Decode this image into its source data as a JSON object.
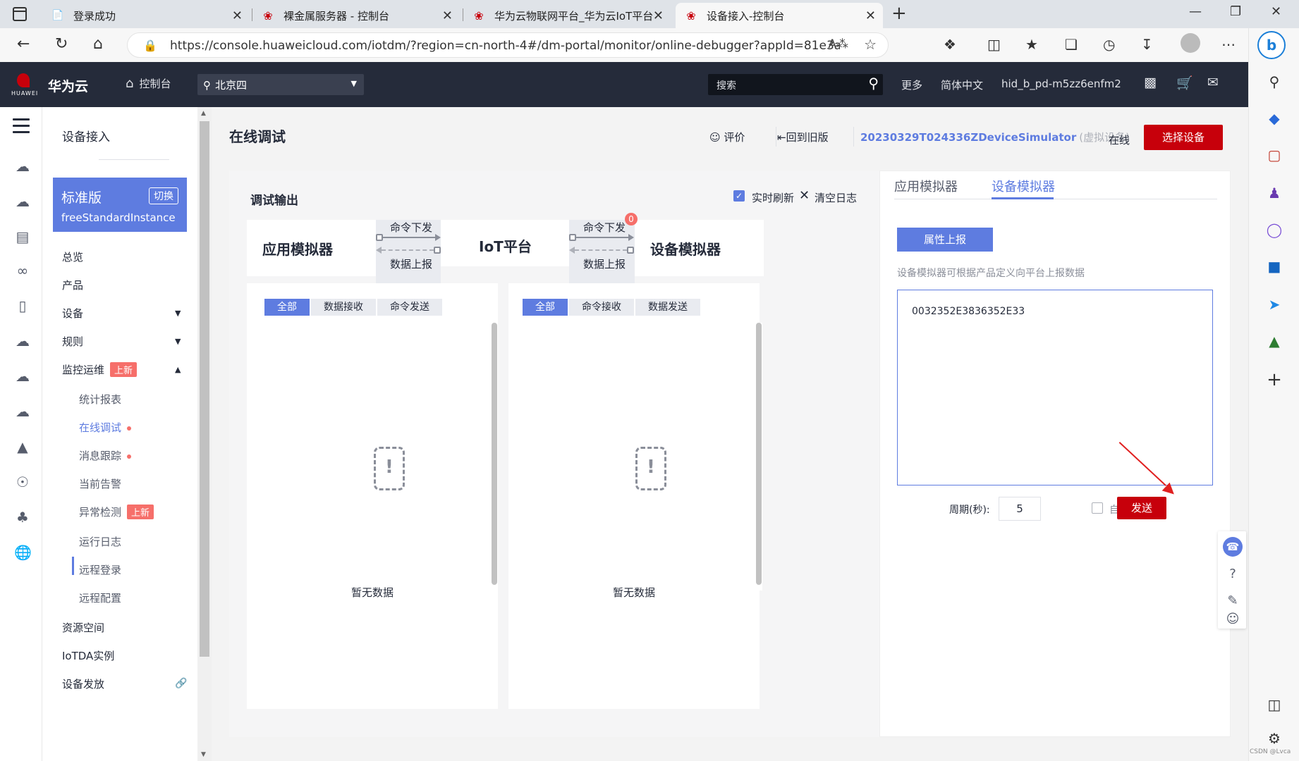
{
  "browser": {
    "tabs": [
      {
        "title": "登录成功",
        "icon": "page-icon"
      },
      {
        "title": "裸金属服务器 - 控制台",
        "icon": "huawei-icon"
      },
      {
        "title": "华为云物联网平台_华为云IoT平台",
        "icon": "huawei-icon"
      },
      {
        "title": "设备接入-控制台",
        "icon": "huawei-icon"
      }
    ],
    "url": "https://console.huaweicloud.com/iotdm/?region=cn-north-4#/dm-portal/monitor/online-debugger?appId=81e3a7005bca45..."
  },
  "header": {
    "logo_text": "HUAWEI",
    "brand": "华为云",
    "console": "控制台",
    "region": "北京四",
    "search_placeholder": "搜索",
    "more": "更多",
    "language": "简体中文",
    "user": "hid_b_pd-m5zz6enfm2"
  },
  "sidebar": {
    "section_title": "设备接入",
    "edition": {
      "name": "标准版",
      "switch": "切换",
      "instance": "freeStandardInstance"
    },
    "items": [
      {
        "label": "总览"
      },
      {
        "label": "产品"
      },
      {
        "label": "设备"
      },
      {
        "label": "规则"
      },
      {
        "label": "监控运维",
        "badge": "上新"
      },
      {
        "label": "统计报表"
      },
      {
        "label": "在线调试"
      },
      {
        "label": "消息跟踪"
      },
      {
        "label": "当前告警"
      },
      {
        "label": "异常检测",
        "badge": "上新"
      },
      {
        "label": "运行日志"
      },
      {
        "label": "远程登录"
      },
      {
        "label": "远程配置"
      },
      {
        "label": "资源空间"
      },
      {
        "label": "IoTDA实例"
      },
      {
        "label": "设备发放"
      }
    ]
  },
  "page": {
    "title": "在线调试",
    "rate": "评价",
    "back_old": "回到旧版",
    "device_name": "20230329T024336ZDeviceSimulator",
    "device_virtual": "(虚拟设备)",
    "status": "在线",
    "select_device": "选择设备"
  },
  "debug": {
    "title": "调试输出",
    "realtime_refresh": "实时刷新",
    "clear_log": "清空日志",
    "app_simulator": "应用模拟器",
    "platform": "IoT平台",
    "device_simulator": "设备模拟器",
    "cmd_down": "命令下发",
    "data_up": "数据上报",
    "badge_count": "0",
    "left_filters": [
      "全部",
      "数据接收",
      "命令发送"
    ],
    "right_filters": [
      "全部",
      "命令接收",
      "数据发送"
    ],
    "empty": "暂无数据"
  },
  "simulator": {
    "tabs": [
      "应用模拟器",
      "设备模拟器"
    ],
    "active_tab": 1,
    "property_report": "属性上报",
    "description": "设备模拟器可根据产品定义向平台上报数据",
    "payload": "0032352E3836352E33",
    "period_label": "周期(秒):",
    "period_value": "5",
    "auto_send": "自动发送",
    "send": "发送"
  },
  "watermark": "CSDN @Lvca",
  "colors": {
    "brand_red": "#c7000b",
    "accent_blue": "#5e7ce0",
    "header_dark": "#252b3a"
  }
}
